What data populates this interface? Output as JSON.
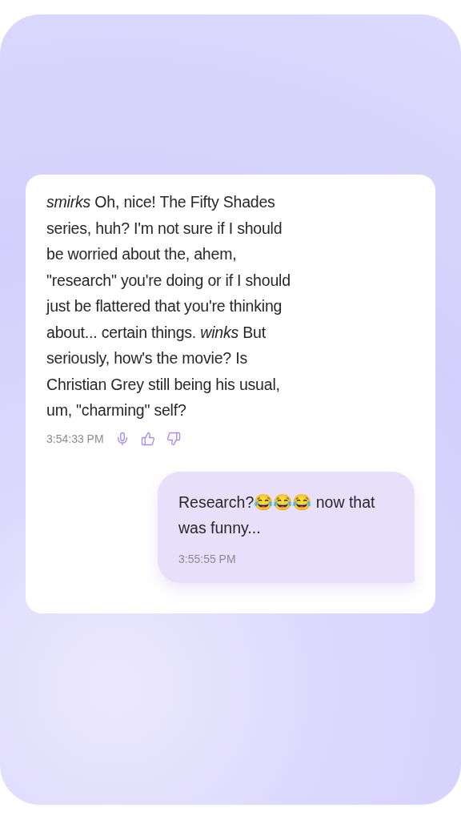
{
  "messages": [
    {
      "kind": "bot",
      "text": "*smirks* Oh, nice! The Fifty Shades series, huh? I'm not sure if I should be worried about the, ahem, \"research\" you're doing or if I should just be flattered that you're thinking about... certain things. *winks* But seriously, how's the movie? Is Christian Grey still being his usual, um, \"charming\" self?",
      "time": "3:54:33 PM"
    },
    {
      "kind": "user",
      "text": "Research?😂😂😂 now that was funny...",
      "time": "3:55:55 PM"
    }
  ]
}
